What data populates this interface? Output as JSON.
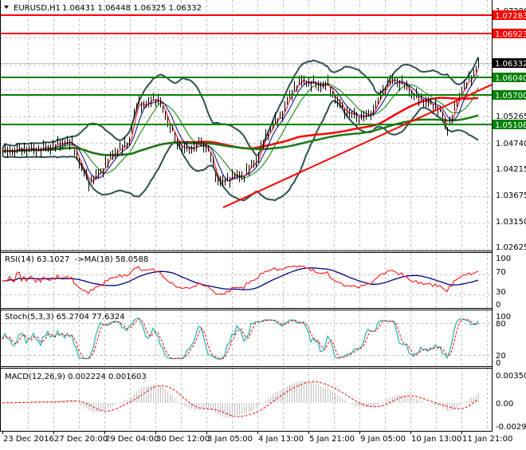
{
  "header": {
    "symbol": "EURUSD,H1",
    "ohlc": "1.06431 1.06448 1.06325 1.06332",
    "menu_icon": "triangle-down-icon"
  },
  "chart_data": [
    {
      "type": "line",
      "title": "EURUSD,H1 1.06431 1.06448 1.06325 1.06332",
      "ylim": [
        1.02625,
        1.0745
      ],
      "y_ticks": [
        "1.07280",
        "1.04740",
        "1.04215",
        "1.03675",
        "1.03150",
        "1.02625",
        "1.05265"
      ],
      "x_labels": [
        "23 Dec 2016",
        "27 Dec 20:00",
        "29 Dec 04:00",
        "30 Dec 12:00",
        "3 Jan 05:00",
        "4 Jan 13:00",
        "5 Jan 21:00",
        "9 Jan 05:00",
        "10 Jan 13:00",
        "11 Jan 21:00"
      ],
      "close": [
        1.0455,
        1.0458,
        1.046,
        1.0462,
        1.046,
        1.0462,
        1.0465,
        1.047,
        1.0478,
        1.0465,
        1.042,
        1.0395,
        1.041,
        1.043,
        1.0455,
        1.0462,
        1.048,
        1.056,
        1.0545,
        1.0565,
        1.055,
        1.051,
        1.0475,
        1.046,
        1.0465,
        1.0475,
        1.046,
        1.04,
        1.0395,
        1.041,
        1.0405,
        1.042,
        1.044,
        1.048,
        1.051,
        1.0525,
        1.056,
        1.059,
        1.0598,
        1.0592,
        1.0588,
        1.059,
        1.056,
        1.054,
        1.053,
        1.0525,
        1.0528,
        1.0545,
        1.058,
        1.06,
        1.0595,
        1.0585,
        1.0565,
        1.056,
        1.055,
        1.0545,
        1.05,
        1.054,
        1.0585,
        1.06,
        1.0633
      ],
      "current_price": {
        "label": "1.06332",
        "value": 1.06332,
        "color": "#000000"
      },
      "levels": [
        {
          "label": "1.07283",
          "value": 1.07283,
          "color": "#ff0000"
        },
        {
          "label": "1.06923",
          "value": 1.06923,
          "color": "#ff0000"
        },
        {
          "label": "1.06040",
          "value": 1.0604,
          "color": "#008000"
        },
        {
          "label": "1.05700",
          "value": 1.057,
          "color": "#008000"
        },
        {
          "label": "1.05108",
          "value": 1.05108,
          "color": "#008000"
        }
      ],
      "trendline": {
        "from": {
          "x": "3 Jan 05:00",
          "y": 1.0345
        },
        "to": {
          "x": "11 Jan 21:00",
          "y": 1.059
        },
        "color": "#ff0000"
      },
      "series_colors": {
        "bars": "#000000",
        "ma_fast": "#ff0000",
        "ma_mid": "#000080",
        "ma_slow": "#008000",
        "ma_long_red": "#ff0000",
        "ma_long_green": "#1a7a1a",
        "bollinger": "#2f4f4f"
      }
    },
    {
      "type": "line",
      "title": "RSI(14) 63.1027  ->MA(18) 58.0588",
      "ylim": [
        0,
        100
      ],
      "y_ticks": [
        "100",
        "70",
        "30",
        "0"
      ],
      "series_colors": {
        "rsi": "#ff0000",
        "ma": "#000080"
      }
    },
    {
      "type": "line",
      "title": "Stoch(5,3,3) 65.2704 77.6324",
      "ylim": [
        0,
        100
      ],
      "y_ticks": [
        "100",
        "80",
        "20",
        "0"
      ],
      "series_colors": {
        "main": "#20b2aa",
        "signal": "#ff0000"
      }
    },
    {
      "type": "bar",
      "title": "MACD(12,26,9) 0.002224 0.001603",
      "ylim": [
        -0.002938,
        0.003502
      ],
      "y_ticks": [
        "0.003502",
        "0.00",
        "-0.002938"
      ],
      "series_colors": {
        "histogram": "#c0c0c0",
        "signal": "#ff0000"
      }
    }
  ]
}
